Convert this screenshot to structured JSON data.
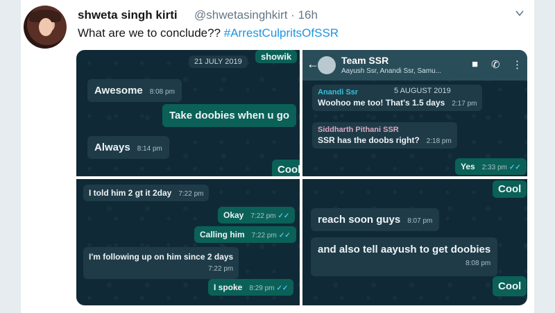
{
  "tweet": {
    "display_name": "shweta singh kirti",
    "handle": "@shwetasinghkirt",
    "separator": "·",
    "time": "16h",
    "text": "What are we to conclude??",
    "hashtag": "#ArrestCulpritsOfSSR",
    "menu_icon": "chevron-down-icon",
    "accent_color": "#1b95e0"
  },
  "screenshots": {
    "panel1": {
      "date": "21 JULY 2019",
      "partial_top": "showik",
      "messages": [
        {
          "text": "Awesome",
          "time": "8:08 pm"
        },
        {
          "text": "Take doobies when u go"
        },
        {
          "text": "Always",
          "time": "8:14 pm"
        },
        {
          "text": "Cool"
        }
      ]
    },
    "panel2": {
      "group_name": "Team SSR",
      "members": "Aayush Ssr, Anandi Ssr, Samu...",
      "date": "5 AUGUST 2019",
      "messages": [
        {
          "sender": "Anandi Ssr",
          "text": "Woohoo me too! That's 1.5 days",
          "time": "2:17 pm"
        },
        {
          "sender": "Siddharth Pithani SSR",
          "text": "SSR has the doobs right?",
          "time": "2:18 pm"
        },
        {
          "text": "Yes",
          "time": "2:33 pm"
        }
      ]
    },
    "panel3": {
      "messages": [
        {
          "text": "I told him 2 gt it 2day",
          "time": "7:22 pm"
        },
        {
          "text": "Okay",
          "time": "7:22 pm"
        },
        {
          "text": "Calling him",
          "time": "7:22 pm"
        },
        {
          "text": "I'm following up on him since 2 days",
          "time": "7:22 pm"
        },
        {
          "text": "I spoke",
          "time": "8:29 pm"
        }
      ]
    },
    "panel4": {
      "messages": [
        {
          "text": "Cool"
        },
        {
          "text": "reach soon guys",
          "time": "8:07 pm"
        },
        {
          "text": "and also tell aayush to get doobies",
          "time": "8:08 pm"
        },
        {
          "text": "Cool"
        }
      ]
    }
  }
}
